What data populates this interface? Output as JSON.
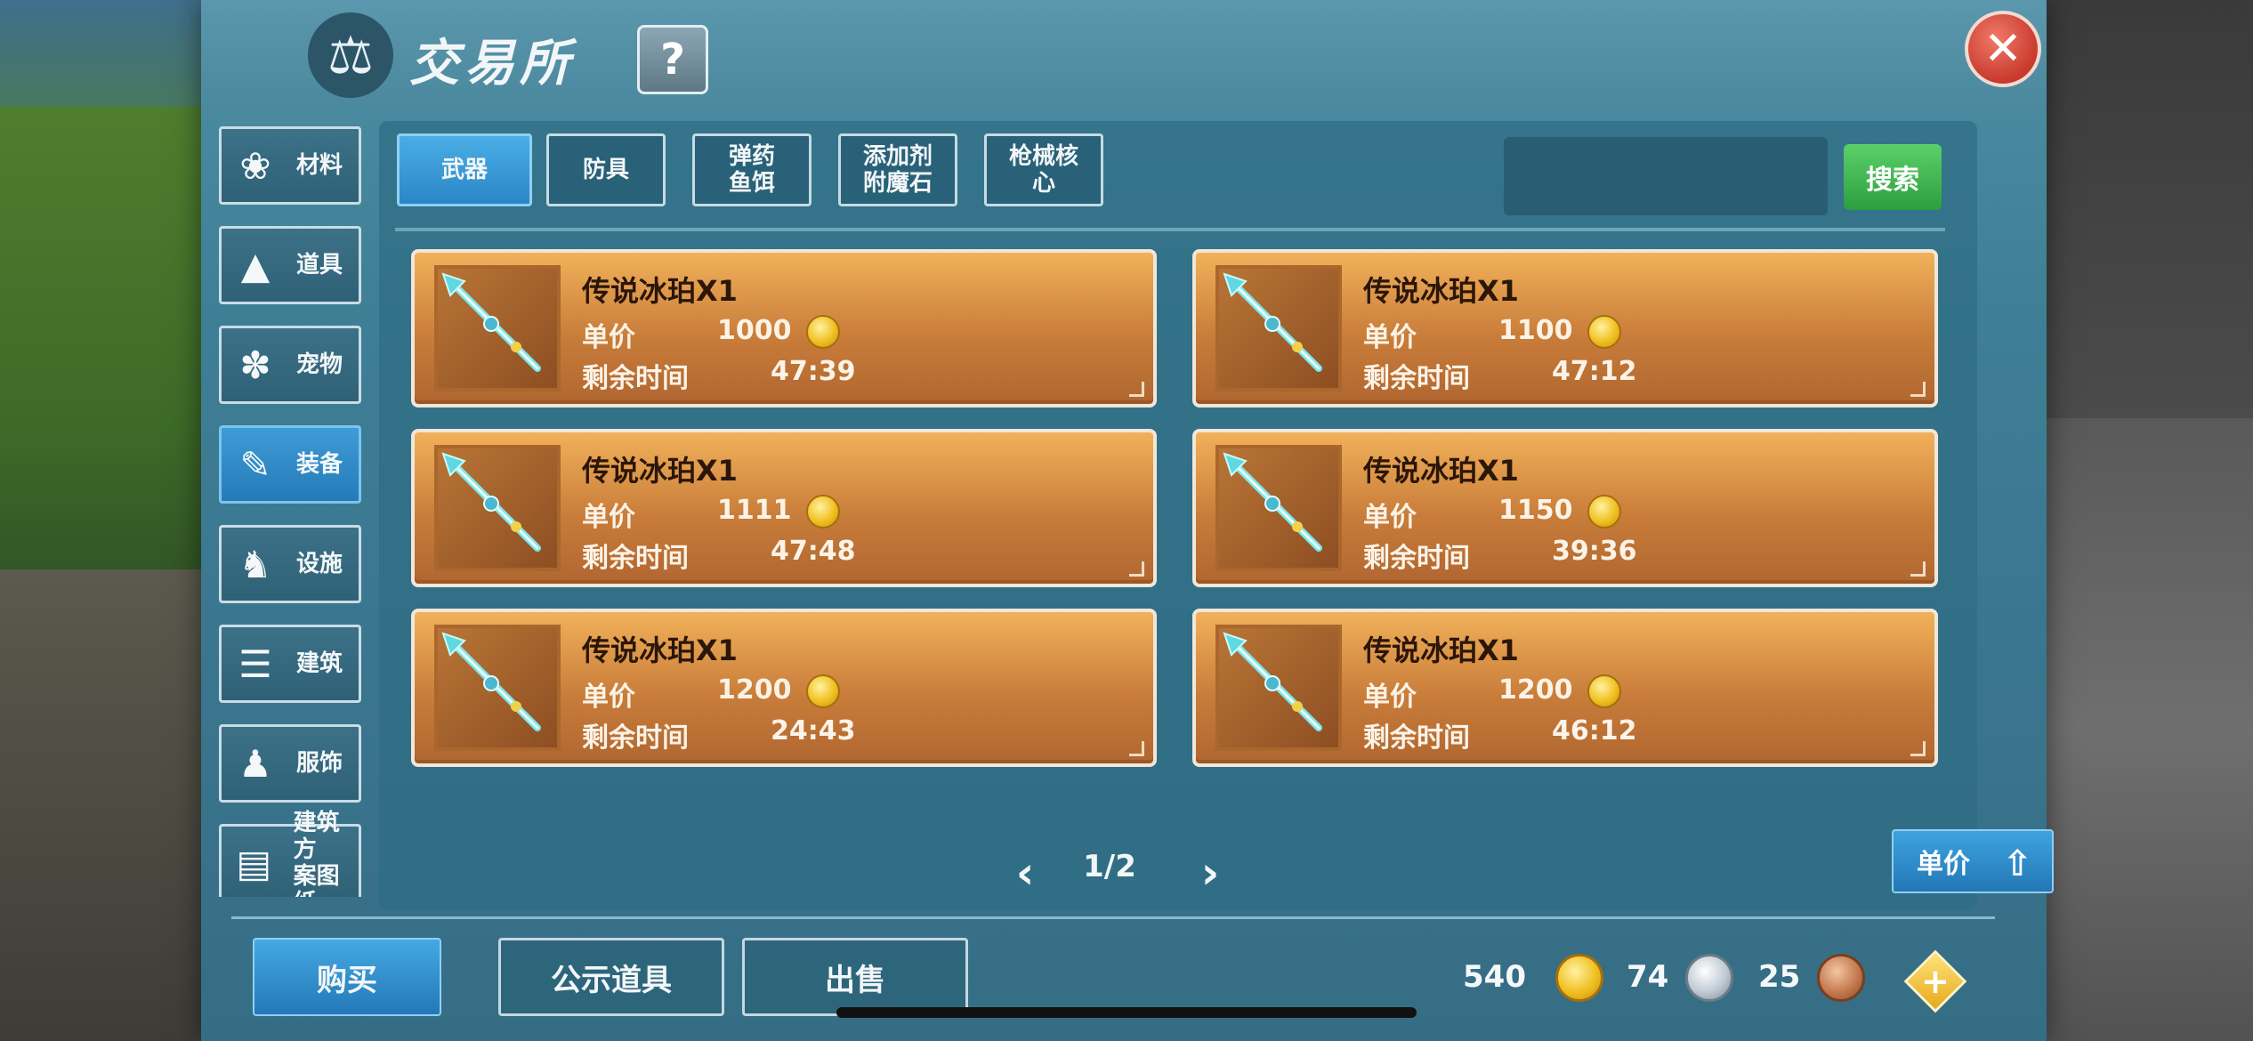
{
  "header": {
    "title": "交易所",
    "help_label": "?",
    "close_label": "✕"
  },
  "sidebar": {
    "items": [
      {
        "label": "材料",
        "icon": "materials-icon",
        "glyph": "❀"
      },
      {
        "label": "道具",
        "icon": "tool-icon",
        "glyph": "▲"
      },
      {
        "label": "宠物",
        "icon": "paw-icon",
        "glyph": "✽"
      },
      {
        "label": "装备",
        "icon": "equipment-icon",
        "glyph": "✎",
        "active": true
      },
      {
        "label": "设施",
        "icon": "facility-icon",
        "glyph": "♞"
      },
      {
        "label": "建筑",
        "icon": "building-icon",
        "glyph": "☰"
      },
      {
        "label": "服饰",
        "icon": "clothing-icon",
        "glyph": "♟"
      },
      {
        "label": "建筑方\n案图纸",
        "icon": "blueprint-icon",
        "glyph": "▤"
      }
    ]
  },
  "tabs": [
    {
      "label": "武器",
      "active": true
    },
    {
      "label": "防具"
    },
    {
      "label": "弹药\n鱼饵"
    },
    {
      "label": "添加剂\n附魔石"
    },
    {
      "label": "枪械核\n心"
    }
  ],
  "search": {
    "value": "",
    "button_label": "搜索"
  },
  "listing_labels": {
    "price": "单价",
    "remaining": "剩余时间"
  },
  "listings": [
    {
      "name": "传说冰珀X1",
      "price": "1000",
      "time": "47:39"
    },
    {
      "name": "传说冰珀X1",
      "price": "1100",
      "time": "47:12"
    },
    {
      "name": "传说冰珀X1",
      "price": "1111",
      "time": "47:48"
    },
    {
      "name": "传说冰珀X1",
      "price": "1150",
      "time": "39:36"
    },
    {
      "name": "传说冰珀X1",
      "price": "1200",
      "time": "24:43"
    },
    {
      "name": "传说冰珀X1",
      "price": "1200",
      "time": "46:12"
    }
  ],
  "pager": {
    "text": "1/2",
    "prev": "‹",
    "next": "›"
  },
  "sort": {
    "label": "单价"
  },
  "actions": {
    "buy": "购买",
    "show": "公示道具",
    "sell": "出售"
  },
  "currency": {
    "gold": "540",
    "silver": "74",
    "copper": "25"
  },
  "colors": {
    "accent_blue": "#2b86c6",
    "card_orange": "#c97d3a",
    "search_green": "#2e9e3f",
    "close_red": "#c83a2c"
  }
}
